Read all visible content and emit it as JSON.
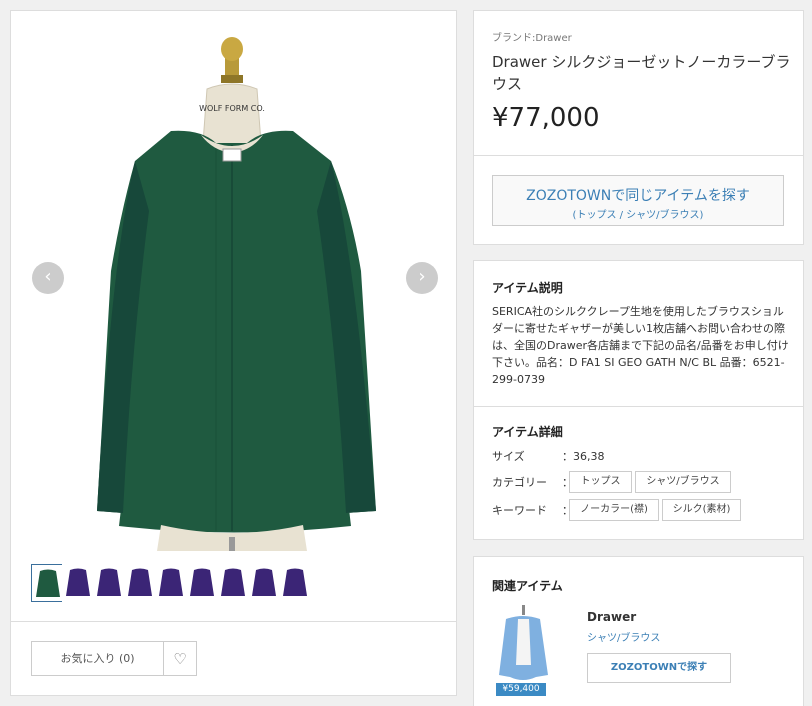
{
  "gallery": {
    "prev_arrow": "‹",
    "next_arrow": "›",
    "mannequin_label": "WOLF FORM CO.",
    "thumbnails": [
      {
        "color": "#1f5a40",
        "active": true
      },
      {
        "color": "#3b2576",
        "active": false
      },
      {
        "color": "#3b2576",
        "active": false
      },
      {
        "color": "#3b2576",
        "active": false
      },
      {
        "color": "#3b2576",
        "active": false
      },
      {
        "color": "#3b2576",
        "active": false
      },
      {
        "color": "#3b2576",
        "active": false
      },
      {
        "color": "#3b2576",
        "active": false
      },
      {
        "color": "#3b2576",
        "active": false
      }
    ],
    "favorite_label": "お気に入り (0)",
    "heart_icon": "♡"
  },
  "product": {
    "brand_line": "ブランド:Drawer",
    "title": "Drawer シルクジョーゼットノーカラーブラウス",
    "price": "¥77,000",
    "zozo_button_main": "ZOZOTOWNで同じアイテムを探す",
    "zozo_button_sub": "(トップス / シャツ/ブラウス)"
  },
  "description": {
    "title": "アイテム説明",
    "text": "SERICA社のシルククレープ生地を使用したブラウスショルダーに寄せたギャザーが美しい1枚店舗へお問い合わせの際は、全国のDrawer各店舗まで下記の品名/品番をお申し付け下さい。品名：D FA1 SI GEO GATH N/C BL 品番：6521-299-0739"
  },
  "details": {
    "title": "アイテム詳細",
    "size_label": "サイズ",
    "size_value": "：36,38",
    "category_label": "カテゴリー",
    "keyword_label": "キーワード",
    "colon": "：",
    "categories": [
      "トップス",
      "シャツ/ブラウス"
    ],
    "keywords": [
      "ノーカラー(襟)",
      "シルク(素材)"
    ]
  },
  "related": {
    "title": "関連アイテム",
    "brand": "Drawer",
    "category": "シャツ/ブラウス",
    "price": "¥59,400",
    "button": "ZOZOTOWNで探す"
  },
  "colors": {
    "accent": "#3b7fb5",
    "blouse": "#1f5a40",
    "price_badge": "#3b8ac4"
  }
}
